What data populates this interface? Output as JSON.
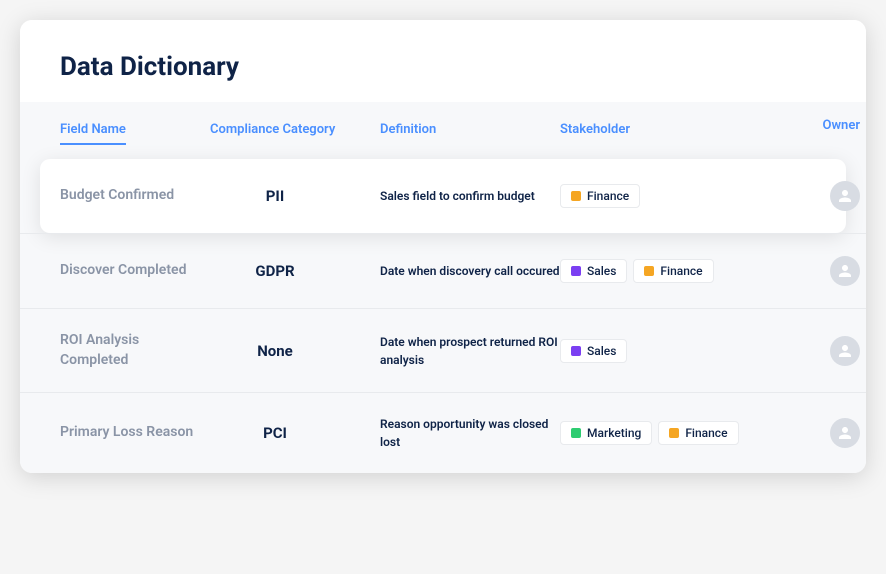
{
  "title": "Data Dictionary",
  "columns": {
    "field_name": "Field Name",
    "compliance": "Compliance Category",
    "definition": "Definition",
    "stakeholder": "Stakeholder",
    "owner": "Owner"
  },
  "tag_colors": {
    "Finance": "#f5a623",
    "Sales": "#7b3ff2",
    "Marketing": "#2ecc71"
  },
  "rows": [
    {
      "field_name": "Budget Confirmed",
      "compliance": "PII",
      "definition": "Sales field to confirm budget",
      "stakeholders": [
        "Finance"
      ],
      "elevated": true
    },
    {
      "field_name": "Discover Completed",
      "compliance": "GDPR",
      "definition": "Date when discovery call occured",
      "stakeholders": [
        "Sales",
        "Finance"
      ],
      "elevated": false
    },
    {
      "field_name": "ROI Analysis Completed",
      "compliance": "None",
      "definition": "Date when prospect returned ROI analysis",
      "stakeholders": [
        "Sales"
      ],
      "elevated": false
    },
    {
      "field_name": "Primary Loss Reason",
      "compliance": "PCI",
      "definition": "Reason opportunity was closed lost",
      "stakeholders": [
        "Marketing",
        "Finance"
      ],
      "elevated": false
    }
  ]
}
